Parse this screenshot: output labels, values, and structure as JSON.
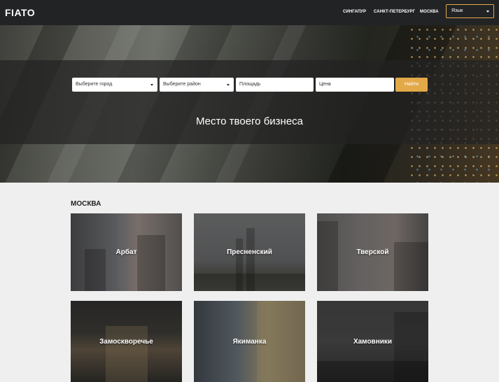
{
  "header": {
    "logo": "FIATO",
    "nav": [
      "СИНГАПУР",
      "САНКТ-ПЕТЕРБУРГ",
      "МОСКВА"
    ],
    "language_label": "Язык"
  },
  "search": {
    "city_placeholder": "Выберите город",
    "district_placeholder": "Выберите район",
    "area_placeholder": "Площадь",
    "price_placeholder": "Цена",
    "submit_label": "Найти",
    "accent_color": "#e3a948"
  },
  "hero": {
    "tagline": "Место твоего бизнеса"
  },
  "section": {
    "title": "МОСКВА",
    "districts": [
      "Арбат",
      "Пресненский",
      "Тверской",
      "Замоскворечье",
      "Якиманка",
      "Хамовники"
    ]
  }
}
